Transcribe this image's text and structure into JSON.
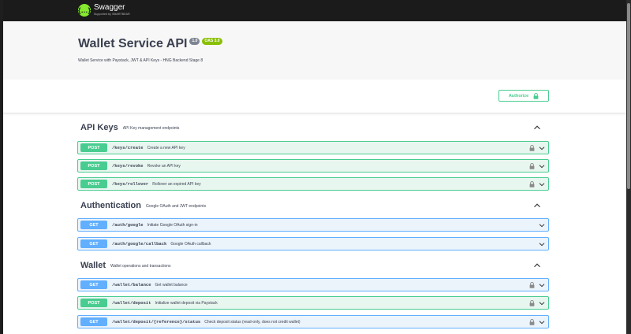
{
  "topbar": {
    "logo_mark": "{…}",
    "logo_name": "Swagger",
    "logo_sub": "Supported by SMARTBEAR"
  },
  "info": {
    "title": "Wallet Service API",
    "version": "1.0",
    "oas": "OAS 3.0",
    "description": "Wallet Service with Paystack, JWT & API Keys - HNG Backend Stage 8"
  },
  "authorize": {
    "label": "Authorize",
    "icon": "lock-icon"
  },
  "colors": {
    "post": "#49cc90",
    "get": "#61affe",
    "brand": "#85ea2d"
  },
  "sections": [
    {
      "name": "API Keys",
      "description": "API Key management endpoints",
      "operations": [
        {
          "method": "POST",
          "path": "/keys/create",
          "summary": "Create a new API key",
          "locked": true
        },
        {
          "method": "POST",
          "path": "/keys/revoke",
          "summary": "Revoke an API key",
          "locked": true
        },
        {
          "method": "POST",
          "path": "/keys/rollover",
          "summary": "Rollover an expired API key",
          "locked": true
        }
      ]
    },
    {
      "name": "Authentication",
      "description": "Google OAuth and JWT endpoints",
      "operations": [
        {
          "method": "GET",
          "path": "/auth/google",
          "summary": "Initiate Google OAuth sign-in",
          "locked": false
        },
        {
          "method": "GET",
          "path": "/auth/google/callback",
          "summary": "Google OAuth callback",
          "locked": false
        }
      ]
    },
    {
      "name": "Wallet",
      "description": "Wallet operations and transactions",
      "operations": [
        {
          "method": "GET",
          "path": "/wallet/balance",
          "summary": "Get wallet balance",
          "locked": true
        },
        {
          "method": "POST",
          "path": "/wallet/deposit",
          "summary": "Initialize wallet deposit via Paystack",
          "locked": true
        },
        {
          "method": "GET",
          "path": "/wallet/deposit/{reference}/status",
          "summary": "Check deposit status (read-only, does not credit wallet)",
          "locked": true
        }
      ]
    }
  ]
}
